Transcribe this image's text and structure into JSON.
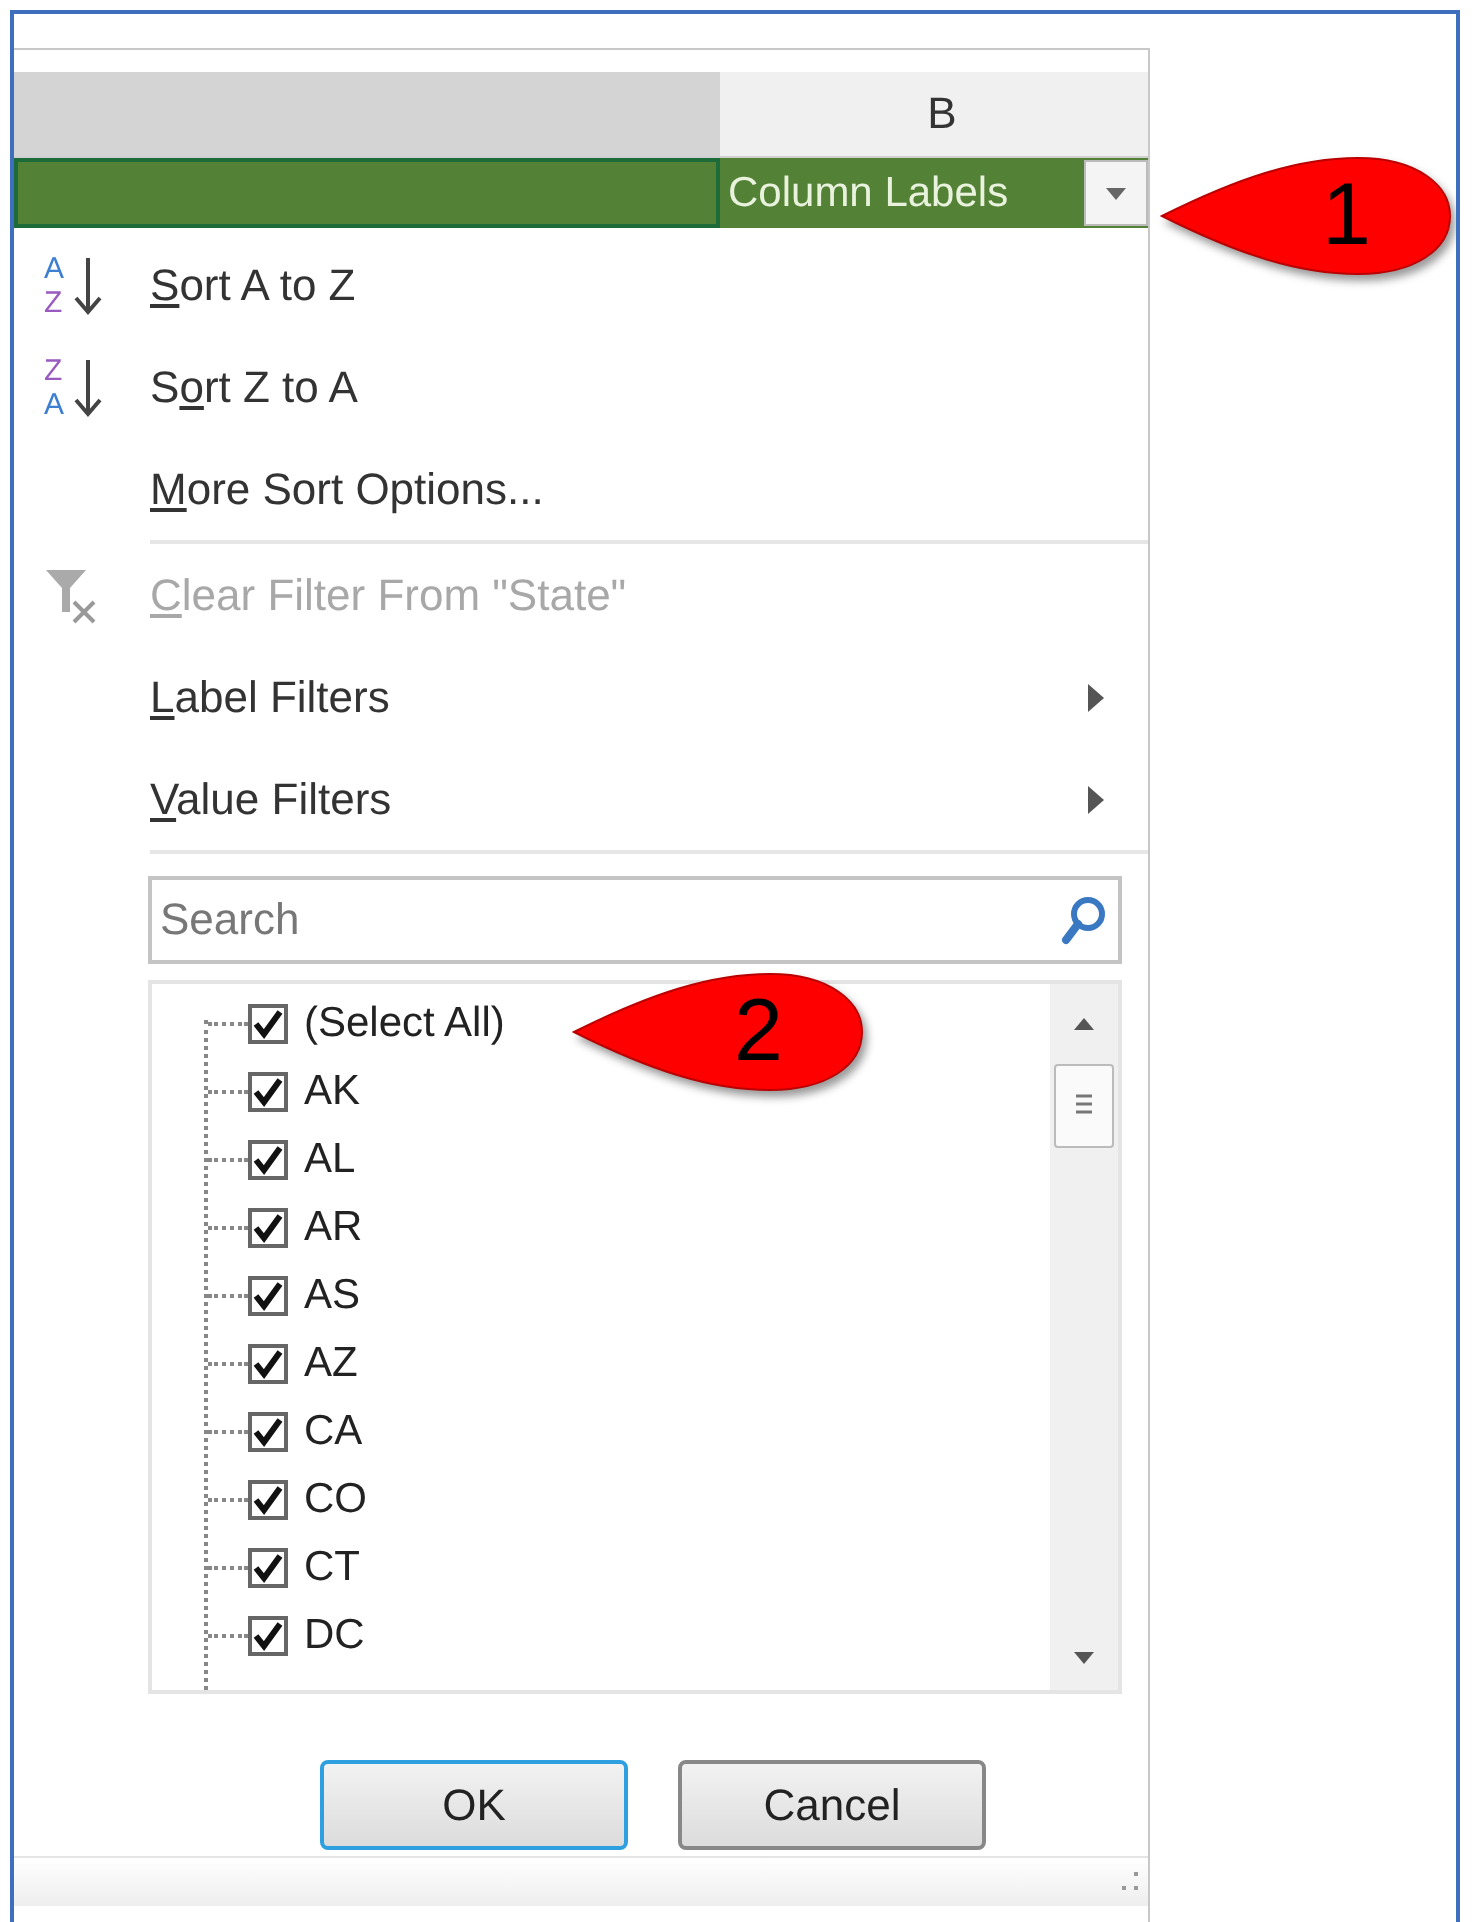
{
  "column_header": {
    "label": "B"
  },
  "pivot_header": {
    "label": "Column Labels"
  },
  "menu_items": [
    {
      "kind": "sort_asc",
      "label_parts": [
        {
          "text": "S",
          "underlined": true
        },
        {
          "text": "ort A to Z",
          "underlined": false
        }
      ],
      "icon_letters": [
        "A",
        "Z"
      ],
      "disabled": false,
      "separator_after": false
    },
    {
      "kind": "sort_desc",
      "label_parts": [
        {
          "text": "S",
          "underlined": false
        },
        {
          "text": "o",
          "underlined": true
        },
        {
          "text": "rt Z to A",
          "underlined": false
        }
      ],
      "icon_letters": [
        "Z",
        "A"
      ],
      "disabled": false,
      "separator_after": false
    },
    {
      "kind": "plain",
      "label_parts": [
        {
          "text": "M",
          "underlined": true
        },
        {
          "text": "ore Sort Options...",
          "underlined": false
        }
      ],
      "disabled": false,
      "separator_after": true
    },
    {
      "kind": "clear_filter",
      "label_parts": [
        {
          "text": "C",
          "underlined": true
        },
        {
          "text": "lear Filter From \"State\"",
          "underlined": false
        }
      ],
      "disabled": true,
      "separator_after": false
    },
    {
      "kind": "submenu",
      "label_parts": [
        {
          "text": "L",
          "underlined": true
        },
        {
          "text": "abel Filters",
          "underlined": false
        }
      ],
      "disabled": false,
      "separator_after": false
    },
    {
      "kind": "submenu",
      "label_parts": [
        {
          "text": "V",
          "underlined": true
        },
        {
          "text": "alue Filters",
          "underlined": false
        }
      ],
      "disabled": false,
      "separator_after": true
    }
  ],
  "search": {
    "placeholder": "Search"
  },
  "filter_list": [
    {
      "label": "(Select All)",
      "checked": true
    },
    {
      "label": "AK",
      "checked": true
    },
    {
      "label": "AL",
      "checked": true
    },
    {
      "label": "AR",
      "checked": true
    },
    {
      "label": "AS",
      "checked": true
    },
    {
      "label": "AZ",
      "checked": true
    },
    {
      "label": "CA",
      "checked": true
    },
    {
      "label": "CO",
      "checked": true
    },
    {
      "label": "CT",
      "checked": true
    },
    {
      "label": "DC",
      "checked": true
    }
  ],
  "buttons": [
    {
      "label": "OK",
      "default": true
    },
    {
      "label": "Cancel",
      "default": false
    }
  ],
  "callouts": [
    {
      "number": "1"
    },
    {
      "number": "2"
    }
  ]
}
